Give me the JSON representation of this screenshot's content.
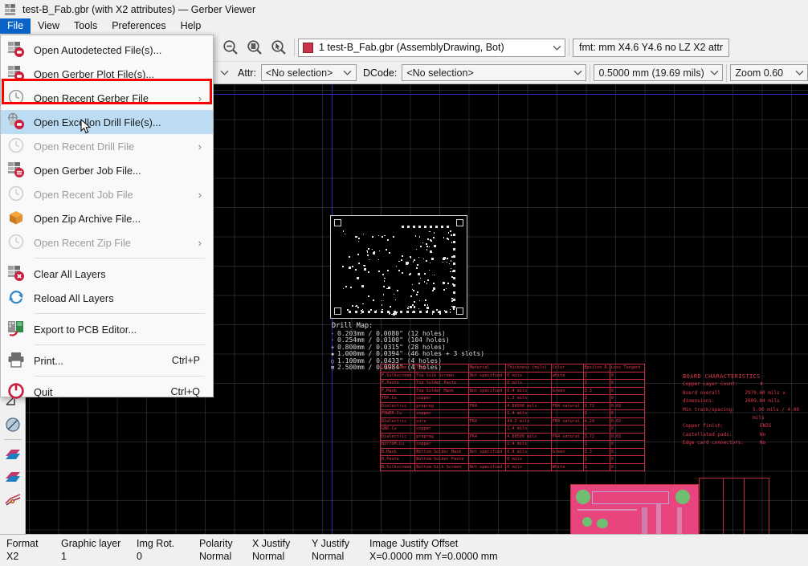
{
  "window": {
    "title": "test-B_Fab.gbr (with X2 attributes) — Gerber Viewer",
    "app_icon": "gerber-viewer-icon"
  },
  "menubar": {
    "items": [
      {
        "label": "File",
        "active": true
      },
      {
        "label": "View",
        "active": false
      },
      {
        "label": "Tools",
        "active": false
      },
      {
        "label": "Preferences",
        "active": false
      },
      {
        "label": "Help",
        "active": false
      }
    ]
  },
  "file_menu": {
    "items": [
      {
        "label": "Open Autodetected File(s)...",
        "icon": "open-autodetected-icon",
        "disabled": false,
        "submenu": false,
        "accel": "",
        "highlighted": false
      },
      {
        "label": "Open Gerber Plot File(s)...",
        "icon": "open-gerber-plot-icon",
        "disabled": false,
        "submenu": false,
        "accel": "",
        "highlighted": false
      },
      {
        "label": "Open Recent Gerber File",
        "icon": "clock-icon",
        "disabled": false,
        "submenu": true,
        "accel": "",
        "highlighted": false
      },
      {
        "label": "Open Excellon Drill File(s)...",
        "icon": "open-excellon-drill-icon",
        "disabled": false,
        "submenu": false,
        "accel": "",
        "highlighted": true
      },
      {
        "label": "Open Recent Drill File",
        "icon": "clock-icon",
        "disabled": true,
        "submenu": true,
        "accel": "",
        "highlighted": false
      },
      {
        "label": "Open Gerber Job File...",
        "icon": "open-gerber-job-icon",
        "disabled": false,
        "submenu": false,
        "accel": "",
        "highlighted": false
      },
      {
        "label": "Open Recent Job File",
        "icon": "clock-icon",
        "disabled": true,
        "submenu": true,
        "accel": "",
        "highlighted": false
      },
      {
        "label": "Open Zip Archive File...",
        "icon": "zip-archive-icon",
        "disabled": false,
        "submenu": false,
        "accel": "",
        "highlighted": false
      },
      {
        "label": "Open Recent Zip File",
        "icon": "clock-icon",
        "disabled": true,
        "submenu": true,
        "accel": "",
        "highlighted": false
      },
      {
        "separator": true
      },
      {
        "label": "Clear All Layers",
        "icon": "clear-all-layers-icon",
        "disabled": false,
        "submenu": false,
        "accel": "",
        "highlighted": false
      },
      {
        "label": "Reload All Layers",
        "icon": "reload-all-layers-icon",
        "disabled": false,
        "submenu": false,
        "accel": "",
        "highlighted": false
      },
      {
        "separator": true
      },
      {
        "label": "Export to PCB Editor...",
        "icon": "export-pcb-editor-icon",
        "disabled": false,
        "submenu": false,
        "accel": "",
        "highlighted": false
      },
      {
        "separator": true
      },
      {
        "label": "Print...",
        "icon": "printer-icon",
        "disabled": false,
        "submenu": false,
        "accel": "Ctrl+P",
        "highlighted": false
      },
      {
        "separator": true
      },
      {
        "label": "Quit",
        "icon": "power-quit-icon",
        "disabled": false,
        "submenu": false,
        "accel": "Ctrl+Q",
        "highlighted": false
      }
    ]
  },
  "toolbar": {
    "zoom_out_icon": "zoom-out-icon",
    "zoom_fit_icon": "zoom-fit-page-icon",
    "zoom_select_icon": "zoom-to-selection-icon",
    "layer_combo": {
      "value": "1 test-B_Fab.gbr (AssemblyDrawing, Bot)",
      "swatch_color": "#c8324b"
    },
    "format_info": "fmt: mm X4.6 Y4.6 no LZ X2 attr",
    "attr_label": "Attr:",
    "attr_value": "<No selection>",
    "dcode_label": "DCode:",
    "dcode_value": "<No selection>",
    "grid_value": "0.5000 mm (19.69 mils)",
    "zoom_value": "Zoom 0.60"
  },
  "left_toolbar": {
    "items": [
      {
        "name": "dcode-display-icon"
      },
      {
        "name": "negative-objects-icon"
      },
      {
        "name": "show-gerber-layers-icon"
      },
      {
        "name": "sketch-mode-icon"
      },
      {
        "name": "highlight-nets-icon"
      }
    ]
  },
  "statusbar": {
    "columns": [
      {
        "header": "Format",
        "value": "X2"
      },
      {
        "header": "Graphic layer",
        "value": "1"
      },
      {
        "header": "Img Rot.",
        "value": "0"
      },
      {
        "header": "Polarity",
        "value": "Normal"
      },
      {
        "header": "X Justify",
        "value": "Normal"
      },
      {
        "header": "Y Justify",
        "value": "Normal"
      },
      {
        "header": "Image Justify Offset",
        "value": "X=0.0000 mm Y=0.0000 mm"
      }
    ]
  },
  "canvas": {
    "drill_map_title": "Drill Map:",
    "drill_map_rows": [
      "0.203mm / 0.0080\" (12 holes)",
      "0.254mm / 0.0100\" (104 holes)",
      "0.800mm / 0.0315\" (28 holes)",
      "1.000mm / 0.0394\" (46 holes + 3 slots)",
      "1.100mm / 0.0433\" (4 holes)",
      "2.500mm / 0.0984\" (4 holes)"
    ],
    "stackup_table": {
      "headers": [
        "Layer name",
        "Type",
        "Material",
        "Thickness (mils)",
        "Color",
        "Epsilon R",
        "Loss Tangent"
      ],
      "rows": [
        [
          "F.Silkscreen",
          "Top Silk Screen",
          "Not specified",
          "0 mils",
          "white",
          "1",
          "0"
        ],
        [
          "F.Paste",
          "Top Solder Paste",
          "",
          "0 mils",
          "",
          "1",
          "0"
        ],
        [
          "F.Mask",
          "Top Solder Mask",
          "Not specified",
          "0.4 mils",
          "Green",
          "3.3",
          "0"
        ],
        [
          "TOP.Cu",
          "copper",
          "",
          "1.3 mils",
          "",
          "1",
          "0"
        ],
        [
          "Dielectric",
          "prepreg",
          "FR4",
          "4.88500 mils",
          "FR4 natural",
          "3.72",
          "0.02"
        ],
        [
          "POWER.Cu",
          "copper",
          "",
          "1.4 mils",
          "",
          "1",
          "0"
        ],
        [
          "Dielectric",
          "core",
          "FR4",
          "44.2 mils",
          "FR4 natural",
          "4.24",
          "0.02"
        ],
        [
          "GND.Cu",
          "copper",
          "",
          "1.4 mils",
          "",
          "1",
          "0"
        ],
        [
          "Dielectric",
          "prepreg",
          "FR4",
          "4.88500 mils",
          "FR4 natural",
          "3.72",
          "0.02"
        ],
        [
          "BOTTOM.Cu",
          "copper",
          "",
          "1.4 mils",
          "",
          "1",
          "0"
        ],
        [
          "B.Mask",
          "Bottom Solder Mask",
          "Not specified",
          "0.4 mils",
          "Green",
          "3.3",
          "0"
        ],
        [
          "B.Paste",
          "Bottom Solder Paste",
          "",
          "0 mils",
          "",
          "1",
          "0"
        ],
        [
          "B.Silkscreen",
          "Bottom Silk Screen",
          "Not specified",
          "0 mils",
          "White",
          "1",
          "0"
        ]
      ]
    },
    "board_characteristics": {
      "title": "BOARD CHARACTERISTICS",
      "rows": [
        {
          "key": "Copper Layer Count:",
          "value": "4"
        },
        {
          "key": "Board overall dimensions:",
          "value": "2970.60 mils x 2009.84 mils"
        },
        {
          "key": "Min track/spacing:",
          "value": "5.90 mils / 4.00 mils"
        },
        {
          "key": "Copper finish:",
          "value": "ENIG"
        },
        {
          "key": "Castellated pads:",
          "value": "No"
        },
        {
          "key": "Edge card connectors:",
          "value": "No"
        }
      ]
    },
    "colors": {
      "background": "#000000",
      "grid": "#5a5a6e",
      "axis": "#2b2bbb",
      "drill_map": "#e6e6e6",
      "fab_layer": "#e23a4e",
      "pcb_copper": "#e8447e",
      "pad_green": "#6fbf73"
    }
  }
}
